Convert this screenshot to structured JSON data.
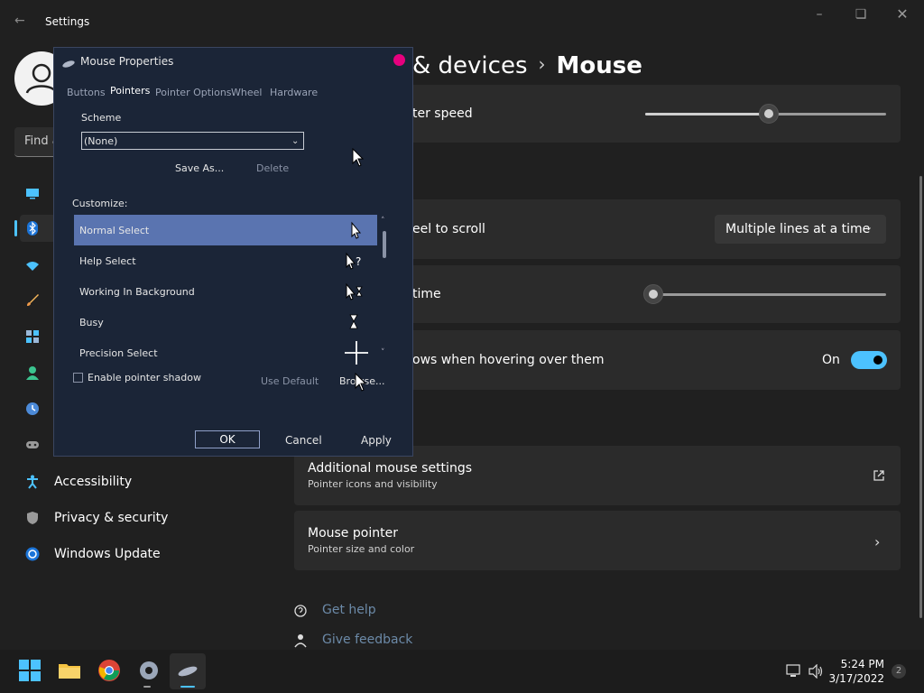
{
  "window": {
    "title": "Settings"
  },
  "sidebar": {
    "search_placeholder": "Find a",
    "items": [
      {
        "label": "Accessibility",
        "icon": "accessibility-icon"
      },
      {
        "label": "Privacy & security",
        "icon": "shield-icon"
      },
      {
        "label": "Windows Update",
        "icon": "update-icon"
      }
    ]
  },
  "header": {
    "crumb_partial": "& devices",
    "separator": "›",
    "page": "Mouse"
  },
  "settings": {
    "pointer_speed_label": "ter speed",
    "pointer_speed_value": 0.51,
    "wheel_scroll_label": "eel to scroll",
    "wheel_scroll_value": "Multiple lines at a time",
    "lines_label": "time",
    "lines_value": 0.03,
    "hover_scroll_label": "ows when hovering over them",
    "hover_scroll_state": "On",
    "related": [
      {
        "title": "Additional mouse settings",
        "subtitle": "Pointer icons and visibility",
        "icon": "open-external-icon"
      },
      {
        "title": "Mouse pointer",
        "subtitle": "Pointer size and color",
        "icon": "chevron-right-icon"
      }
    ],
    "get_help": "Get help",
    "give_feedback": "Give feedback"
  },
  "dialog": {
    "title": "Mouse Properties",
    "tabs": [
      "Buttons",
      "Pointers",
      "Pointer Options",
      "Wheel",
      "Hardware"
    ],
    "active_tab": "Pointers",
    "scheme_label": "Scheme",
    "scheme_value": "(None)",
    "save_as": "Save As...",
    "delete": "Delete",
    "customize_label": "Customize:",
    "cursors": [
      {
        "label": "Normal Select",
        "glyph": "arrow-cursor-icon"
      },
      {
        "label": "Help Select",
        "glyph": "help-cursor-icon"
      },
      {
        "label": "Working In Background",
        "glyph": "working-cursor-icon"
      },
      {
        "label": "Busy",
        "glyph": "hourglass-cursor-icon"
      },
      {
        "label": "Precision Select",
        "glyph": "crosshair-cursor-icon"
      }
    ],
    "enable_shadow": "Enable pointer shadow",
    "use_default": "Use Default",
    "browse": "Browse...",
    "ok": "OK",
    "cancel": "Cancel",
    "apply": "Apply"
  },
  "taskbar": {
    "time": "5:24 PM",
    "date": "3/17/2022",
    "notifications": "2"
  }
}
